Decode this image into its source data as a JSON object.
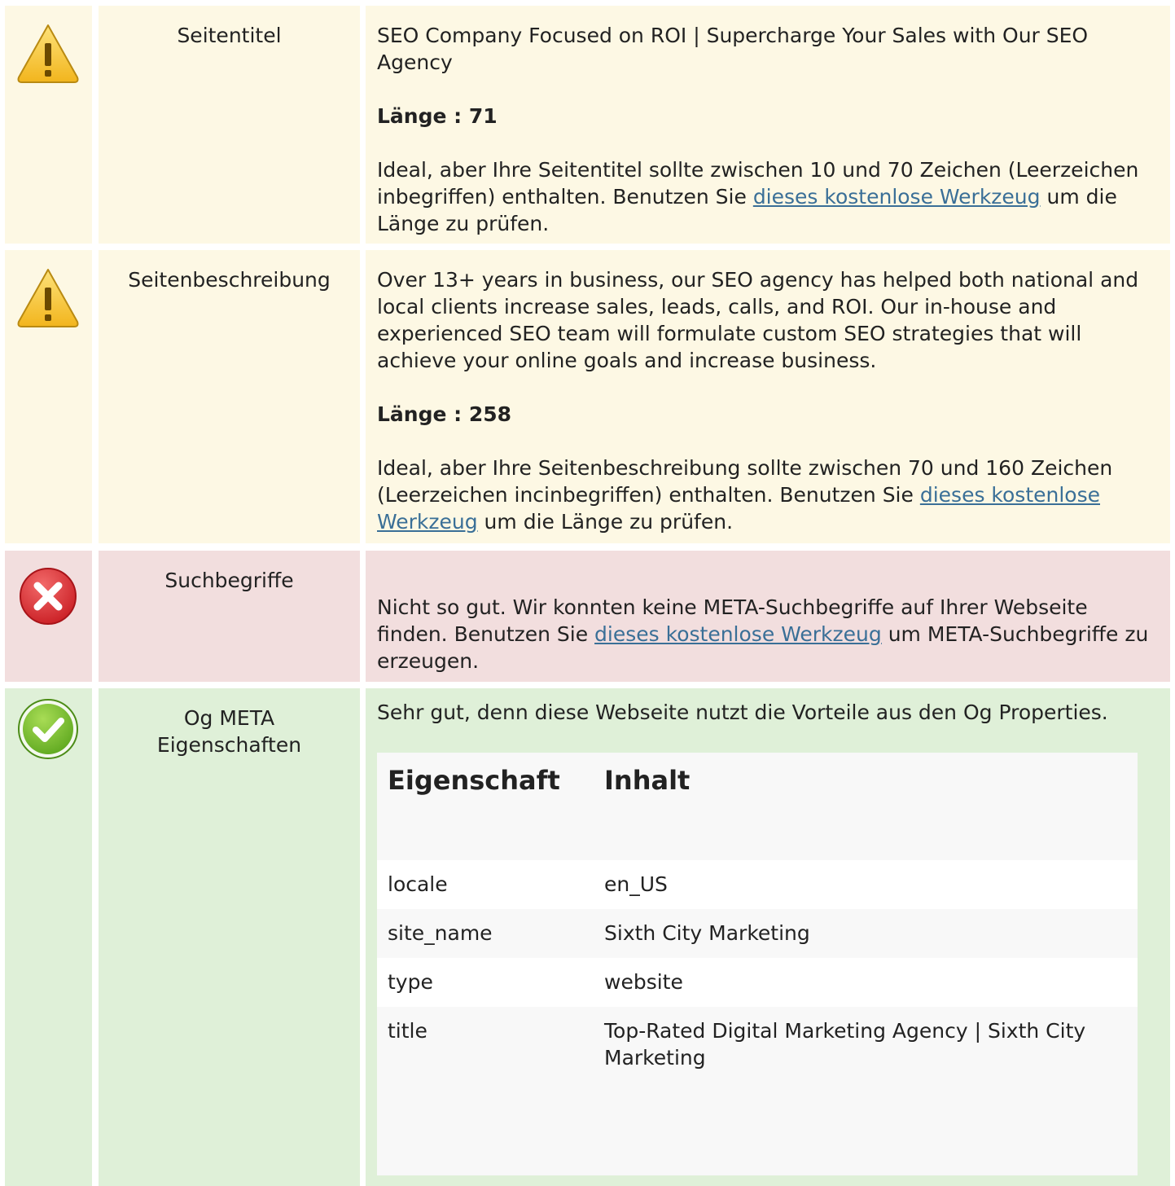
{
  "rows": {
    "title": {
      "status_icon": "warning-icon",
      "label": "Seitentitel",
      "value": "SEO Company Focused on ROI | Supercharge Your Sales with Our SEO Agency",
      "length_text": "Länge : 71",
      "advice_before": "Ideal, aber Ihre Seitentitel sollte zwischen 10 und 70 Zeichen (Leerzeichen inbegriffen) enthalten. Benutzen Sie ",
      "advice_link": "dieses kostenlose Werkzeug",
      "advice_after": " um die Länge zu prüfen."
    },
    "description": {
      "status_icon": "warning-icon",
      "label": "Seitenbeschreibung",
      "value": "Over 13+ years in business, our SEO agency has helped both national and local clients increase sales, leads, calls, and ROI. Our in-house and experienced SEO team will formulate custom SEO strategies that will achieve your online goals and increase business.",
      "length_text": "Länge : 258",
      "advice_before": "Ideal, aber Ihre Seitenbeschreibung sollte zwischen 70 und 160 Zeichen (Leerzeichen incinbegriffen) enthalten. Benutzen Sie ",
      "advice_link": "dieses kostenlose Werkzeug",
      "advice_after": " um die Länge zu prüfen."
    },
    "keywords": {
      "status_icon": "error-icon",
      "label": "Suchbegriffe",
      "advice_before": "Nicht so gut. Wir konnten keine META-Suchbegriffe auf Ihrer Webseite finden. Benutzen Sie ",
      "advice_link": "dieses kostenlose Werkzeug",
      "advice_after": " um META-Suchbegriffe zu erzeugen."
    },
    "og": {
      "status_icon": "check-icon",
      "label": "Og META Eigenschaften",
      "summary": "Sehr gut, denn diese Webseite nutzt die Vorteile aus den Og Properties.",
      "table": {
        "col_property": "Eigenschaft",
        "col_content": "Inhalt",
        "items": [
          {
            "property": "locale",
            "content": "en_US"
          },
          {
            "property": "site_name",
            "content": "Sixth City Marketing"
          },
          {
            "property": "type",
            "content": "website"
          },
          {
            "property": "title",
            "content": "Top-Rated Digital Marketing Agency | Sixth City Marketing"
          }
        ]
      }
    }
  },
  "colors": {
    "warning_bg": "#fdf8e4",
    "error_bg": "#f2dede",
    "success_bg": "#dff0d8",
    "link": "#3a6f97"
  }
}
